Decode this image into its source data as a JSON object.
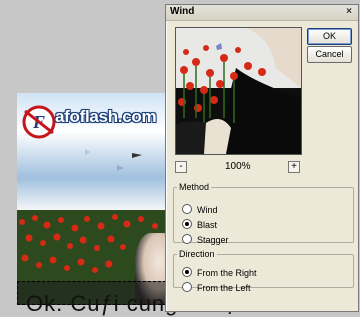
{
  "dialog": {
    "title": "Wind",
    "close_glyph": "×",
    "ok_label": "OK",
    "cancel_label": "Cancel",
    "zoom": {
      "minus": "-",
      "value": "100%",
      "plus": "+"
    },
    "method": {
      "legend": "Method",
      "options": [
        "Wind",
        "Blast",
        "Stagger"
      ],
      "selected": "Blast"
    },
    "direction": {
      "legend": "Direction",
      "options": [
        "From the Right",
        "From the Left"
      ],
      "selected": "From the Right"
    }
  },
  "canvas": {
    "brand": "afoflash.com",
    "logo_letter": "F"
  },
  "caption": {
    "text": "Ok. Cuƒi cung la sợ đ"
  },
  "colors": {
    "dialog_bg": "#ece9d8",
    "poppy_red": "#d62a14",
    "sky_blue": "#9fc0de"
  }
}
